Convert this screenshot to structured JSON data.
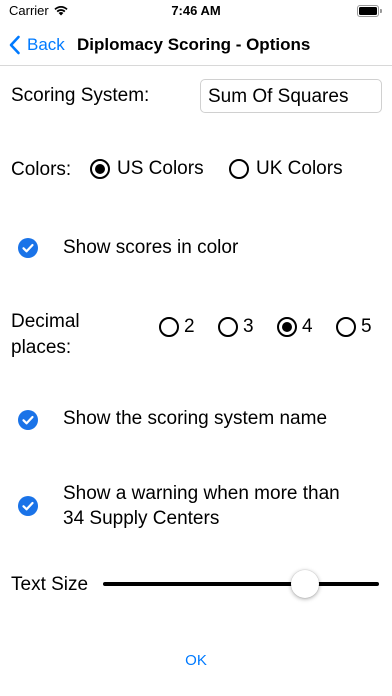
{
  "status_bar": {
    "carrier": "Carrier",
    "time": "7:46 AM",
    "wifi_icon": "wifi-icon",
    "battery_icon": "battery-icon"
  },
  "nav": {
    "back_label": "Back",
    "title": "Diplomacy Scoring - Options"
  },
  "scoring": {
    "label": "Scoring System:",
    "value": "Sum Of Squares"
  },
  "colors": {
    "label": "Colors:",
    "options": [
      {
        "label": "US Colors",
        "selected": true
      },
      {
        "label": "UK Colors",
        "selected": false
      }
    ]
  },
  "show_color": {
    "label": "Show scores in color",
    "checked": true
  },
  "decimal": {
    "label_line1": "Decimal",
    "label_line2": "places:",
    "options": [
      {
        "label": "2",
        "selected": false
      },
      {
        "label": "3",
        "selected": false
      },
      {
        "label": "4",
        "selected": true
      },
      {
        "label": "5",
        "selected": false
      }
    ]
  },
  "show_system_name": {
    "label": "Show the scoring system name",
    "checked": true
  },
  "warning": {
    "label_line1": "Show a warning when more than",
    "label_line2": "34 Supply Centers",
    "checked": true
  },
  "text_size": {
    "label": "Text Size",
    "value_fraction": 0.76
  },
  "ok_label": "OK",
  "accent_color": "#007aff",
  "check_color": "#1a73e8"
}
